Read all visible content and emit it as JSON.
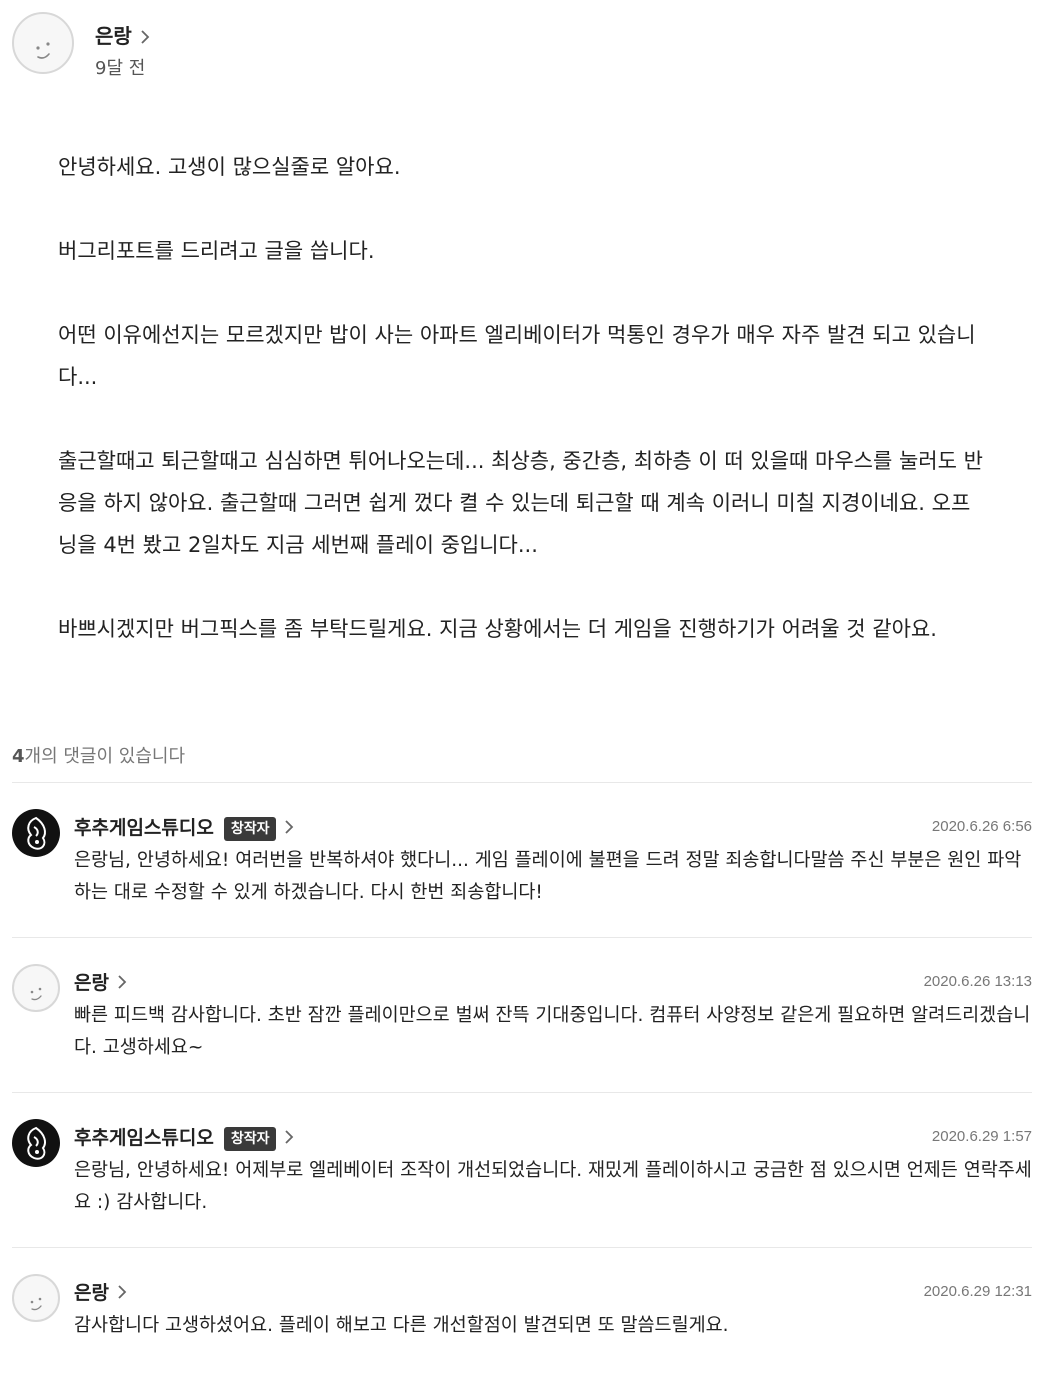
{
  "post": {
    "author": "은랑",
    "time": "9달 전",
    "paragraphs": [
      "안녕하세요. 고생이 많으실줄로 알아요.",
      "버그리포트를 드리려고 글을 씁니다.",
      "어떤 이유에선지는 모르겠지만 밥이 사는 아파트 엘리베이터가 먹통인 경우가 매우 자주 발견 되고 있습니다...",
      "출근할때고 퇴근할때고 심심하면 튀어나오는데... 최상층, 중간층, 최하층 이 떠 있을때 마우스를 눌러도 반응을 하지 않아요. 출근할때 그러면 쉽게 껐다 켤 수 있는데 퇴근할 때 계속 이러니 미칠 지경이네요. 오프닝을 4번 봤고 2일차도 지금 세번째 플레이 중입니다...",
      "바쁘시겠지만 버그픽스를 좀 부탁드릴게요. 지금 상황에서는 더 게임을 진행하기가 어려울 것 같아요."
    ]
  },
  "comment_count": {
    "number": "4",
    "suffix": "개의 댓글이 있습니다"
  },
  "comments": [
    {
      "author": "후추게임스튜디오",
      "badge": "창작자",
      "date": "2020.6.26 6:56",
      "text": "은랑님, 안녕하세요! 여러번을 반복하셔야 했다니... 게임 플레이에 불편을 드려 정말 죄송합니다말씀 주신 부분은 원인 파악하는 대로 수정할 수 있게 하겠습니다. 다시 한번 죄송합니다!"
    },
    {
      "author": "은랑",
      "date": "2020.6.26 13:13",
      "text": "빠른 피드백 감사합니다. 초반 잠깐 플레이만으로 벌써 잔뜩 기대중입니다. 컴퓨터 사양정보 같은게 필요하면 알려드리겠습니다. 고생하세요~"
    },
    {
      "author": "후추게임스튜디오",
      "badge": "창작자",
      "date": "2020.6.29 1:57",
      "text": "은랑님, 안녕하세요! 어제부로 엘레베이터 조작이 개선되었습니다. 재밌게 플레이하시고 궁금한 점 있으시면 언제든 연락주세요 :) 감사합니다."
    },
    {
      "author": "은랑",
      "date": "2020.6.29 12:31",
      "text": "감사합니다 고생하셨어요. 플레이 해보고 다른 개선할점이 발견되면 또 말씀드릴게요."
    }
  ],
  "icons": {
    "user_avatar": "smiley-face-icon",
    "studio_avatar": "studio-logo-icon",
    "chevron": "chevron-right-icon"
  },
  "colors": {
    "badge_bg": "#3a3a3a",
    "text": "#222222",
    "muted": "#777777",
    "divider": "#e8e8e8"
  }
}
